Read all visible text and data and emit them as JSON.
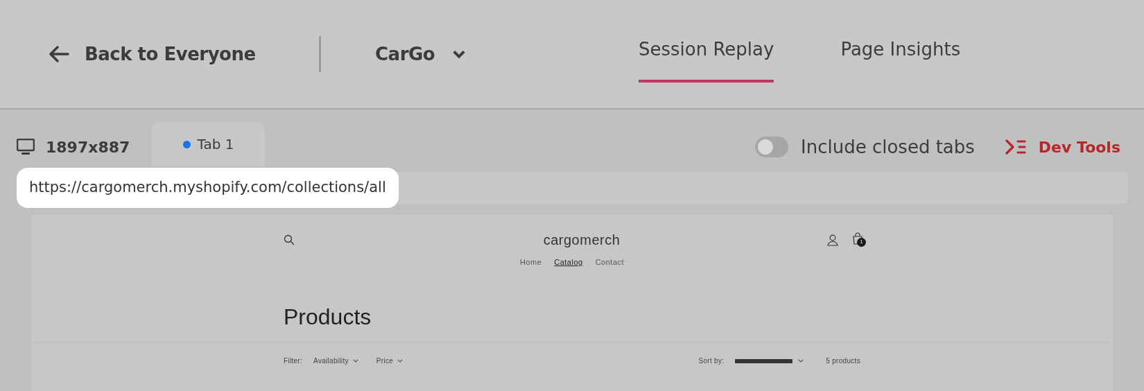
{
  "header": {
    "back_link": "Back to Everyone",
    "project": "CarGo",
    "tabs": [
      {
        "label": "Session Replay",
        "selected": true
      },
      {
        "label": "Page Insights",
        "selected": false
      }
    ]
  },
  "session": {
    "resolution": "1897x887",
    "browser_tabs": [
      {
        "label": "Tab 1",
        "selected": true,
        "color": "#1a73e8"
      }
    ],
    "include_closed_tabs": {
      "label": "Include closed tabs",
      "on": false
    },
    "dev_tools": "Dev Tools",
    "url": "https://cargomerch.myshopify.com/collections/all"
  },
  "preview": {
    "store_name": "cargomerch",
    "cart_count": "1",
    "nav": [
      {
        "label": "Home",
        "selected": false
      },
      {
        "label": "Catalog",
        "selected": true
      },
      {
        "label": "Contact",
        "selected": false
      }
    ],
    "heading": "Products",
    "filter_label": "Filter:",
    "filters": [
      "Availability",
      "Price"
    ],
    "sort_label": "Sort by:",
    "product_count": "5 products"
  }
}
